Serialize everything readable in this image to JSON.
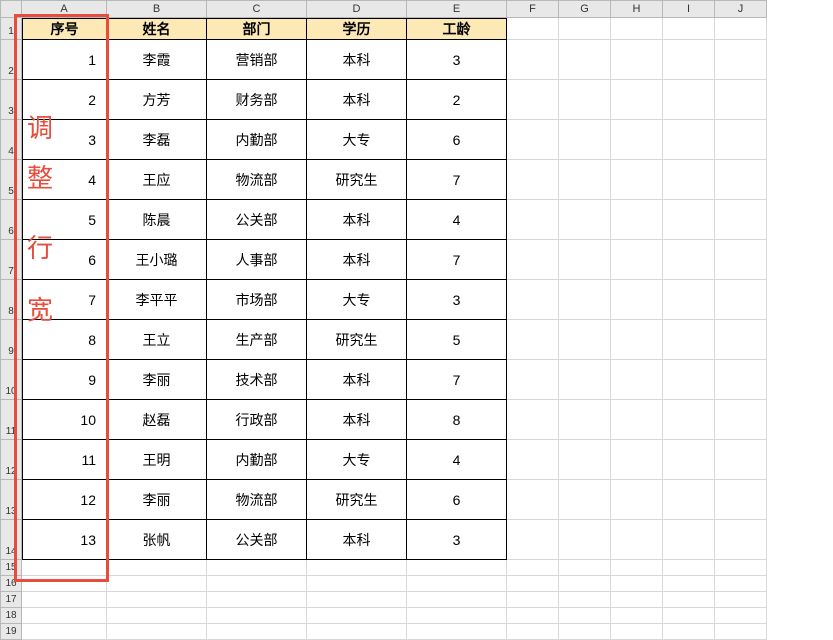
{
  "columns": [
    "A",
    "B",
    "C",
    "D",
    "E",
    "F",
    "G",
    "H",
    "I",
    "J"
  ],
  "rowNumbers": [
    1,
    2,
    3,
    4,
    5,
    6,
    7,
    8,
    9,
    10,
    11,
    12,
    13,
    14,
    15,
    16,
    17,
    18,
    19
  ],
  "headers": {
    "seq": "序号",
    "name": "姓名",
    "dept": "部门",
    "edu": "学历",
    "years": "工龄"
  },
  "rows": [
    {
      "seq": "1",
      "name": "李霞",
      "dept": "营销部",
      "edu": "本科",
      "years": "3"
    },
    {
      "seq": "2",
      "name": "方芳",
      "dept": "财务部",
      "edu": "本科",
      "years": "2"
    },
    {
      "seq": "3",
      "name": "李磊",
      "dept": "内勤部",
      "edu": "大专",
      "years": "6"
    },
    {
      "seq": "4",
      "name": "王应",
      "dept": "物流部",
      "edu": "研究生",
      "years": "7"
    },
    {
      "seq": "5",
      "name": "陈晨",
      "dept": "公关部",
      "edu": "本科",
      "years": "4"
    },
    {
      "seq": "6",
      "name": "王小璐",
      "dept": "人事部",
      "edu": "本科",
      "years": "7"
    },
    {
      "seq": "7",
      "name": "李平平",
      "dept": "市场部",
      "edu": "大专",
      "years": "3"
    },
    {
      "seq": "8",
      "name": "王立",
      "dept": "生产部",
      "edu": "研究生",
      "years": "5"
    },
    {
      "seq": "9",
      "name": "李丽",
      "dept": "技术部",
      "edu": "本科",
      "years": "7"
    },
    {
      "seq": "10",
      "name": "赵磊",
      "dept": "行政部",
      "edu": "本科",
      "years": "8"
    },
    {
      "seq": "11",
      "name": "王明",
      "dept": "内勤部",
      "edu": "大专",
      "years": "4"
    },
    {
      "seq": "12",
      "name": "李丽",
      "dept": "物流部",
      "edu": "研究生",
      "years": "6"
    },
    {
      "seq": "13",
      "name": "张帆",
      "dept": "公关部",
      "edu": "本科",
      "years": "3"
    }
  ],
  "overlay": {
    "c1": "调",
    "c2": "整",
    "c3": "行",
    "c4": "宽"
  }
}
